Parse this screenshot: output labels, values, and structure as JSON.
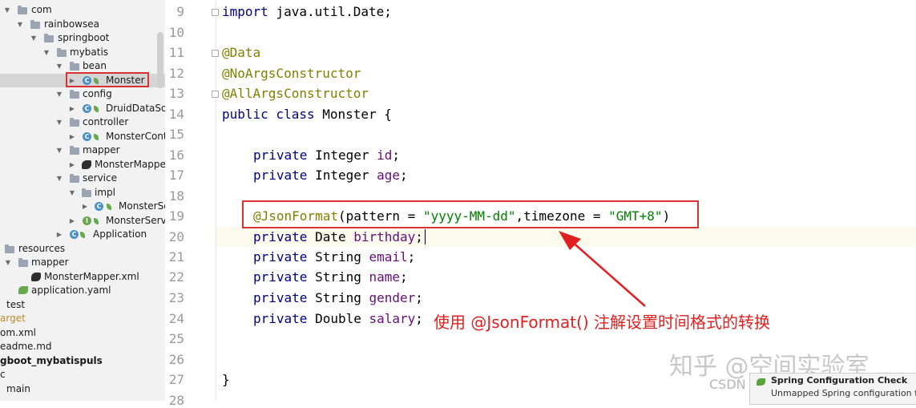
{
  "project_tree": {
    "items": [
      {
        "label": "com",
        "icon": "folder-icon"
      },
      {
        "label": "rainbowsea",
        "icon": "folder-icon"
      },
      {
        "label": "springboot",
        "icon": "folder-icon"
      },
      {
        "label": "mybatis",
        "icon": "folder-icon"
      },
      {
        "label": "bean",
        "icon": "folder-icon"
      },
      {
        "label": "Monster",
        "icon": "class-icon"
      },
      {
        "label": "config",
        "icon": "folder-icon"
      },
      {
        "label": "DruidDataSour",
        "icon": "class-icon"
      },
      {
        "label": "controller",
        "icon": "folder-icon"
      },
      {
        "label": "MonsterContro",
        "icon": "class-icon"
      },
      {
        "label": "mapper",
        "icon": "folder-icon"
      },
      {
        "label": "MonsterMapper",
        "icon": "mybatis-icon"
      },
      {
        "label": "service",
        "icon": "folder-icon"
      },
      {
        "label": "impl",
        "icon": "folder-icon"
      },
      {
        "label": "MonsterSe",
        "icon": "class-icon"
      },
      {
        "label": "MonsterServic",
        "icon": "interface-icon"
      },
      {
        "label": "Application",
        "icon": "spring-app-icon"
      },
      {
        "label": "resources",
        "icon": "folder-icon"
      },
      {
        "label": "mapper",
        "icon": "folder-icon"
      },
      {
        "label": "MonsterMapper.xml",
        "icon": "mybatis-icon"
      },
      {
        "label": "application.yaml",
        "icon": "spring-config-icon"
      },
      {
        "label": "test",
        "icon": "folder-icon"
      },
      {
        "label": "arget",
        "icon": "folder-icon"
      },
      {
        "label": "om.xml",
        "icon": "file-icon"
      },
      {
        "label": "eadme.md",
        "icon": "file-icon"
      },
      {
        "label": "gboot_mybatispuls",
        "icon": "folder-icon"
      },
      {
        "label": "c",
        "icon": "folder-icon"
      },
      {
        "label": "main",
        "icon": "folder-icon"
      }
    ],
    "selected": "Monster"
  },
  "editor": {
    "line_numbers": [
      "9",
      "10",
      "11",
      "12",
      "13",
      "14",
      "15",
      "16",
      "17",
      "18",
      "19",
      "20",
      "21",
      "22",
      "23",
      "24",
      "25",
      "26",
      "27",
      "28"
    ],
    "code": {
      "import_kw": "import",
      "import_rest": " java.util.Date;",
      "ann_data": "@Data",
      "ann_noargs": "@NoArgsConstructor",
      "ann_allargs": "@AllArgsConstructor",
      "class_kw": "public class",
      "class_name": " Monster {",
      "private": "private",
      "t_integer": " Integer ",
      "t_date": " Date ",
      "t_string": " String ",
      "t_double": " Double ",
      "f_id": "id",
      "f_age": "age",
      "f_birthday": "birthday",
      "f_email": "email",
      "f_name": "name",
      "f_gender": "gender",
      "f_salary": "salary",
      "semi": ";",
      "json_ann": "@JsonFormat",
      "json_a": "(pattern = ",
      "json_pattern": "\"yyyy-MM-dd\"",
      "json_b": ",timezone = ",
      "json_tz": "\"GMT+8\"",
      "json_c": ")",
      "close_brace": "}"
    },
    "annotation_note": "使用 @JsonFormat() 注解设置时间格式的转换"
  },
  "watermark": {
    "line1": "知乎 @空间实验室",
    "line2": "CSDN @ChinaRainbowSea"
  },
  "notification": {
    "title": "Spring Configuration Check",
    "detail": "Unmapped Spring configuration file"
  },
  "colors": {
    "highlight_red": "#d83232",
    "keyword": "#000080",
    "annotation": "#808000",
    "string": "#008000",
    "field": "#660e7a"
  }
}
